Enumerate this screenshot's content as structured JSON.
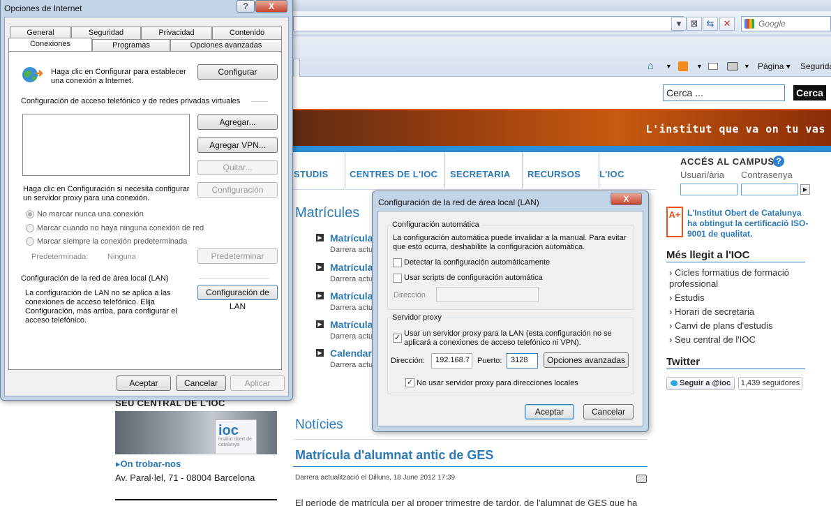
{
  "browser": {
    "search_placeholder": "Google",
    "cmd_page": "Página",
    "cmd_security": "Segurida"
  },
  "site": {
    "search_placeholder": "Cerca ...",
    "search_button": "Cerca",
    "slogan": "L'institut que va on tu vas",
    "nav": [
      "STUDIS",
      "CENTRES DE L'IOC",
      "SECRETARIA",
      "RECURSOS",
      "L'IOC"
    ],
    "acces_title": "ACCÉS AL CAMPUS",
    "user_label": "Usuari/ària",
    "password_label": "Contrasenya",
    "iso_badge": "A+",
    "iso_text": "L'Institut Obert de Catalunya ha obtingut la certificació ISO-9001 de qualitat.",
    "mes_llegit_title": "Més llegit a l'IOC",
    "mes_llegit": [
      "Cicles formatius de formació professional",
      "Estudis",
      "Horari de secretaria",
      "Canvi de plans d'estudis",
      "Seu central de l'IOC"
    ],
    "twitter_title": "Twitter",
    "twitter_follow": "Seguir a @ioc",
    "twitter_count": "1,439 seguidores",
    "matricules_title": "Matrícules",
    "matricules_items": [
      {
        "link": "Matrícula",
        "sub": "Darrera actu"
      },
      {
        "link": "Matrícula",
        "sub": "Darrera actu"
      },
      {
        "link": "Matrícula",
        "sub": "Darrera actu"
      },
      {
        "link": "Matrícula",
        "sub": "Darrera actu"
      },
      {
        "link": "Calendari",
        "sub": "Darrera actu"
      }
    ],
    "noticies_title": "Notícies",
    "news_title": "Matrícula d'alumnat antic de GES",
    "news_date": "Darrera actualització el Dilluns, 18 June 2012 17:39",
    "news_body": "El període de matrícula per al proper trimestre de tardor, de l'alumnat de GES que ha",
    "seu_title": "SEU CENTRAL DE L'IOC",
    "ioc_sign": "ioc",
    "ioc_sign_sub": "institut obert de catalunya",
    "on_trobar": "On trobar-nos",
    "adreca": "Av. Paral·lel, 71 - 08004 Barcelona"
  },
  "internet_options": {
    "title": "Opciones de Internet",
    "help_btn": "?",
    "close_btn": "X",
    "tabs_row1": [
      "General",
      "Seguridad",
      "Privacidad",
      "Contenido"
    ],
    "tabs_row2": [
      "Conexiones",
      "Programas",
      "Opciones avanzadas"
    ],
    "setup_text": "Haga clic en Configurar para establecer una conexión a Internet.",
    "setup_button": "Configurar",
    "dialup_title": "Configuración de acceso telefónico y de redes privadas virtuales",
    "add_button": "Agregar...",
    "add_vpn_button": "Agregar VPN...",
    "remove_button": "Quitar...",
    "proxy_text": "Haga clic en Configuración si necesita configurar un servidor proxy para una conexión.",
    "settings_button": "Configuración",
    "radio_never": "No marcar nunca una conexión",
    "radio_whenever": "Marcar cuando no haya ninguna conexión de red",
    "radio_always": "Marcar siempre la conexión predeterminada",
    "default_label": "Predeterminada:",
    "default_value": "Ninguna",
    "set_default_button": "Predeterminar",
    "lan_title": "Configuración de la red de área local (LAN)",
    "lan_text": "La configuración de LAN no se aplica a las conexiones de acceso telefónico. Elija Configuración, más arriba, para configurar el acceso telefónico.",
    "lan_button": "Configuración de LAN",
    "ok": "Aceptar",
    "cancel": "Cancelar",
    "apply": "Aplicar"
  },
  "lan_dialog": {
    "title": "Configuración de la red de área local (LAN)",
    "close_btn": "X",
    "auto_group": "Configuración automática",
    "auto_text": "La configuración automática puede invalidar a la manual. Para evitar que esto ocurra, deshabilite la configuración automática.",
    "detect_label": "Detectar la configuración automáticamente",
    "script_label": "Usar scripts de configuración automática",
    "address_label": "Dirección",
    "proxy_group": "Servidor proxy",
    "use_proxy_label": "Usar un servidor proxy para la LAN (esta configuración no se aplicará a conexiones de acceso telefónico ni VPN).",
    "proxy_address_label": "Dirección:",
    "proxy_address_value": "192.168.7",
    "port_label": "Puerto:",
    "port_value": "3128",
    "advanced_button": "Opciones avanzadas",
    "bypass_label": "No usar servidor proxy para direcciones locales",
    "ok": "Aceptar",
    "cancel": "Cancelar"
  }
}
